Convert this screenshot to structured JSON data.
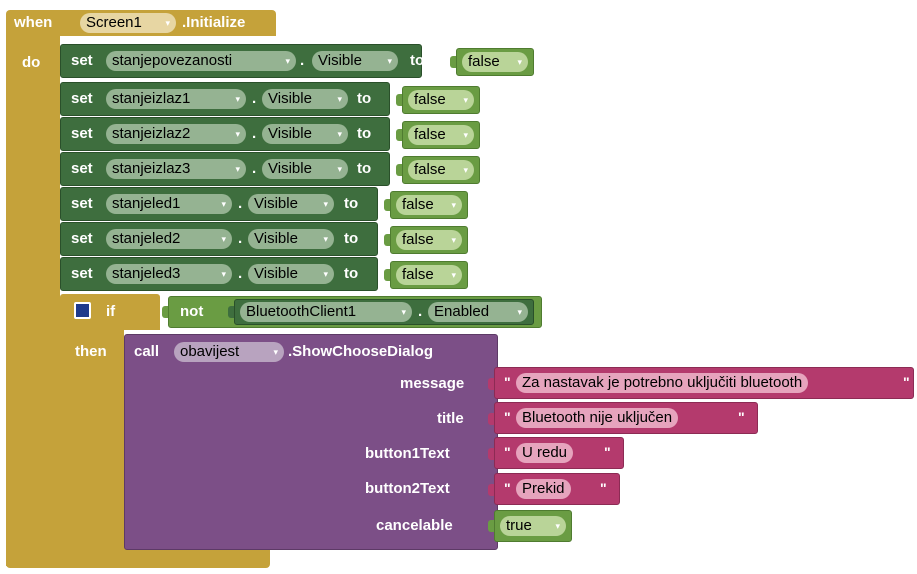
{
  "event": {
    "when": "when",
    "component": "Screen1",
    "event_name": ".Initialize",
    "do": "do"
  },
  "set_blocks": [
    {
      "set": "set",
      "component": "stanjepovezanosti",
      "property": "Visible",
      "to": "to",
      "value": "false"
    },
    {
      "set": "set",
      "component": "stanjeizlaz1",
      "property": "Visible",
      "to": "to",
      "value": "false"
    },
    {
      "set": "set",
      "component": "stanjeizlaz2",
      "property": "Visible",
      "to": "to",
      "value": "false"
    },
    {
      "set": "set",
      "component": "stanjeizlaz3",
      "property": "Visible",
      "to": "to",
      "value": "false"
    },
    {
      "set": "set",
      "component": "stanjeled1",
      "property": "Visible",
      "to": "to",
      "value": "false"
    },
    {
      "set": "set",
      "component": "stanjeled2",
      "property": "Visible",
      "to": "to",
      "value": "false"
    },
    {
      "set": "set",
      "component": "stanjeled3",
      "property": "Visible",
      "to": "to",
      "value": "false"
    }
  ],
  "if_block": {
    "if": "if",
    "then": "then",
    "not": "not",
    "component": "BluetoothClient1",
    "property": "Enabled",
    "dot": "."
  },
  "call_block": {
    "call": "call",
    "component": "obavijest",
    "method": ".ShowChooseDialog",
    "params": [
      {
        "label": "message",
        "value": "Za nastavak je potrebno uključiti bluetooth"
      },
      {
        "label": "title",
        "value": "Bluetooth nije uključen"
      },
      {
        "label": "button1Text",
        "value": "U redu"
      },
      {
        "label": "button2Text",
        "value": "Prekid"
      },
      {
        "label": "cancelable",
        "value": "true"
      }
    ]
  },
  "symbols": {
    "dot": ".",
    "quote": "\"",
    "dropdown": "▾",
    "mutator": "gear-icon"
  },
  "colors": {
    "event": "#c5a23a",
    "set_block": "#3e6e3e",
    "logic": "#6a9c43",
    "procedure": "#7c4f87",
    "text": "#b43a6d",
    "mutator": "#1e3a8c"
  }
}
